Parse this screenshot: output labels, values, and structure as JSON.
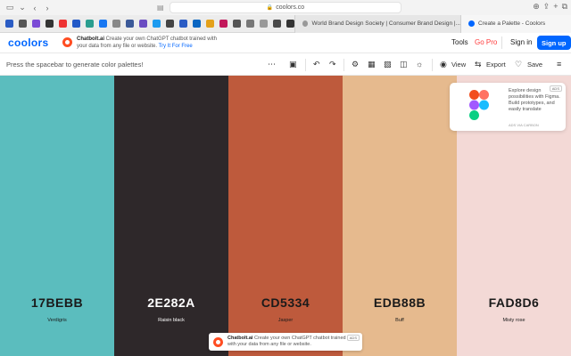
{
  "browser": {
    "url": "coolors.co",
    "tabs": [
      "World Brand Design Society | Consumer Brand Design |...",
      "Create a Palette - Coolors"
    ]
  },
  "header": {
    "logo": "coolors",
    "promo_title": "Chatbolt.ai",
    "promo_text": "Create your own ChatGPT chatbot trained with your data from any file or website.",
    "promo_link": "Try It For Free",
    "nav_tools": "Tools",
    "nav_gopro": "Go Pro",
    "nav_signin": "Sign in",
    "nav_signup": "Sign up"
  },
  "toolbar": {
    "hint": "Press the spacebar to generate color palettes!",
    "view_label": "View",
    "export_label": "Export",
    "save_label": "Save"
  },
  "palette": [
    {
      "hex": "17BEBB",
      "name": "Verdigris",
      "color": "#5BBDBE",
      "text_color": "#1a1a1a"
    },
    {
      "hex": "2E282A",
      "name": "Raisin black",
      "color": "#2E282A",
      "text_color": "#ffffff"
    },
    {
      "hex": "CD5334",
      "name": "Jasper",
      "color": "#BE5A3C",
      "text_color": "#1a1a1a"
    },
    {
      "hex": "EDB88B",
      "name": "Buff",
      "color": "#E6BA8E",
      "text_color": "#1a1a1a"
    },
    {
      "hex": "FAD8D6",
      "name": "Misty rose",
      "color": "#F3D9D6",
      "text_color": "#1a1a1a"
    }
  ],
  "ad_card": {
    "badge": "ADS",
    "text": "Explore design possibilities with Figma. Build prototypes, and easily translate",
    "sub": "ADS VIA CARBON"
  },
  "bottom_ad": {
    "badge": "ADS",
    "title": "Chatbolt.ai",
    "text": "Create your own ChatGPT chatbot trained with your data from any file or website."
  }
}
